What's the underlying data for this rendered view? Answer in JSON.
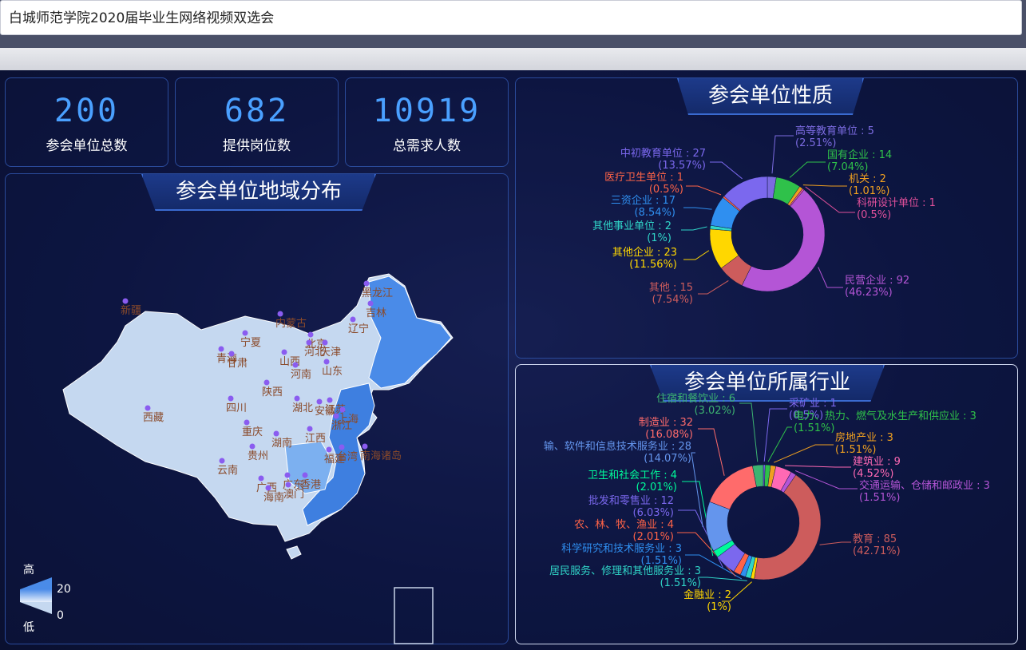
{
  "title_bar": {
    "value": "白城师范学院2020届毕业生网络视频双选会"
  },
  "stats": [
    {
      "value": "200",
      "label": "参会单位总数"
    },
    {
      "value": "682",
      "label": "提供岗位数"
    },
    {
      "value": "10919",
      "label": "总需求人数"
    }
  ],
  "map_panel": {
    "title": "参会单位地域分布",
    "legend": {
      "high": "高",
      "low": "低",
      "max": "20",
      "min": "0"
    },
    "provinces": [
      "黑龙江",
      "吉林",
      "辽宁",
      "新疆",
      "内蒙古",
      "宁夏",
      "青海",
      "甘肃",
      "北京",
      "天津",
      "山西",
      "河北",
      "山东",
      "河南",
      "陕西",
      "西藏",
      "四川",
      "湖北",
      "安徽",
      "江苏",
      "上海",
      "浙江",
      "重庆",
      "湖南",
      "江西",
      "贵州",
      "福建",
      "台湾",
      "云南",
      "广西",
      "广东",
      "香港",
      "海南",
      "澳门",
      "南海诸岛"
    ]
  },
  "nature_panel": {
    "title": "参会单位性质",
    "chart_data": {
      "type": "pie",
      "donut": true,
      "slices": [
        {
          "name": "高等教育单位",
          "value": 5,
          "pct": "2.51%",
          "color": "#7b6be0"
        },
        {
          "name": "国有企业",
          "value": 14,
          "pct": "7.04%",
          "color": "#2fc14a"
        },
        {
          "name": "机关",
          "value": 2,
          "pct": "1.01%",
          "color": "#f0a020"
        },
        {
          "name": "科研设计单位",
          "value": 1,
          "pct": "0.5%",
          "color": "#e0509a"
        },
        {
          "name": "民营企业",
          "value": 92,
          "pct": "46.23%",
          "color": "#b455d6"
        },
        {
          "name": "其他",
          "value": 15,
          "pct": "7.54%",
          "color": "#cd5c5c"
        },
        {
          "name": "其他企业",
          "value": 23,
          "pct": "11.56%",
          "color": "#ffd700"
        },
        {
          "name": "其他事业单位",
          "value": 2,
          "pct": "1%",
          "color": "#30d5c8"
        },
        {
          "name": "三资企业",
          "value": 17,
          "pct": "8.54%",
          "color": "#2f8ff0"
        },
        {
          "name": "医疗卫生单位",
          "value": 1,
          "pct": "0.5%",
          "color": "#ff6347"
        },
        {
          "name": "中初教育单位",
          "value": 27,
          "pct": "13.57%",
          "color": "#7b68ee"
        }
      ]
    }
  },
  "industry_panel": {
    "title": "参会单位所属行业",
    "chart_data": {
      "type": "pie",
      "donut": true,
      "slices": [
        {
          "name": "采矿业",
          "value": 1,
          "pct": "0.5%",
          "color": "#7b68ee"
        },
        {
          "name": "电力、热力、燃气及水生产和供应业",
          "value": 3,
          "pct": "1.51%",
          "color": "#2fc14a"
        },
        {
          "name": "房地产业",
          "value": 3,
          "pct": "1.51%",
          "color": "#f0a020"
        },
        {
          "name": "建筑业",
          "value": 9,
          "pct": "4.52%",
          "color": "#ff69b4"
        },
        {
          "name": "交通运输、仓储和邮政业",
          "value": 3,
          "pct": "1.51%",
          "color": "#b455d6"
        },
        {
          "name": "教育",
          "value": 85,
          "pct": "42.71%",
          "color": "#cd5c5c"
        },
        {
          "name": "金融业",
          "value": 2,
          "pct": "1%",
          "color": "#ffd700"
        },
        {
          "name": "居民服务、修理和其他服务业",
          "value": 3,
          "pct": "1.51%",
          "color": "#30d5c8"
        },
        {
          "name": "科学研究和技术服务业",
          "value": 3,
          "pct": "1.51%",
          "color": "#2f8ff0"
        },
        {
          "name": "农、林、牧、渔业",
          "value": 4,
          "pct": "2.01%",
          "color": "#ff6347"
        },
        {
          "name": "批发和零售业",
          "value": 12,
          "pct": "6.03%",
          "color": "#7b68ee"
        },
        {
          "name": "卫生和社会工作",
          "value": 4,
          "pct": "2.01%",
          "color": "#00fa9a"
        },
        {
          "name": "输、软件和信息技术服务业",
          "value": 28,
          "pct": "14.07%",
          "color": "#6495ed"
        },
        {
          "name": "制造业",
          "value": 32,
          "pct": "16.08%",
          "color": "#ff6b6b"
        },
        {
          "name": "住宿和餐饮业",
          "value": 6,
          "pct": "3.02%",
          "color": "#3cb371"
        }
      ]
    }
  }
}
